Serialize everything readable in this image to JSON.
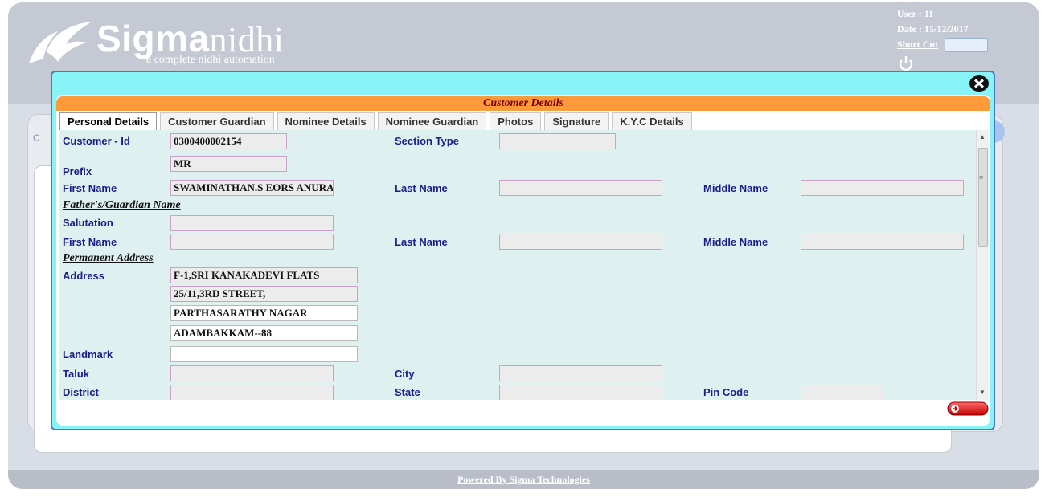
{
  "header": {
    "logo_bold": "Sigma",
    "logo_light": "nidhi",
    "tagline": "a complete nidhi automation",
    "user": "User : 11",
    "date": "Date : 15/12/2017",
    "shortcut_label": "Short Cut",
    "shortcut_value": ""
  },
  "background": {
    "left_stub": "C"
  },
  "modal": {
    "title": "Customer Details",
    "tabs": [
      "Personal Details",
      "Customer Guardian",
      "Nominee Details",
      "Nominee Guardian",
      "Photos",
      "Signature",
      "K.Y.C Details"
    ],
    "active_tab": "Personal Details",
    "labels": {
      "customer_id": "Customer - Id",
      "section_type": "Section Type",
      "prefix": "Prefix",
      "first_name": "First Name",
      "last_name": "Last Name",
      "middle_name": "Middle Name",
      "fathers_section": "Father's/Guardian Name",
      "salutation": "Salutation",
      "g_first_name": "First Name",
      "g_last_name": "Last Name",
      "g_middle_name": "Middle Name",
      "permanent_section": "Permanent Address",
      "address": "Address",
      "landmark": "Landmark",
      "taluk": "Taluk",
      "city": "City",
      "district": "District",
      "state": "State",
      "pin_code": "Pin Code"
    },
    "values": {
      "customer_id": "0300400002154",
      "section_type": "",
      "prefix": "MR",
      "first_name": "SWAMINATHAN.S EORS ANURA",
      "last_name": "",
      "middle_name": "",
      "salutation": "",
      "g_first_name": "",
      "g_last_name": "",
      "g_middle_name": "",
      "address1": "F-1,SRI KANAKADEVI FLATS",
      "address2": "25/11,3RD STREET,",
      "address3": "PARTHASARATHY NAGAR",
      "address4": "ADAMBAKKAM--88",
      "landmark": "",
      "taluk": "",
      "city": "",
      "district": "",
      "state": "",
      "pin_code": ""
    }
  },
  "footer": {
    "text": "Powered By Sigma Technologies"
  },
  "colors": {
    "modal_frame": "#88f4f8",
    "title_bar": "#ff9a3a",
    "form_bg": "#dff0f0",
    "label": "#1c1c8a"
  }
}
